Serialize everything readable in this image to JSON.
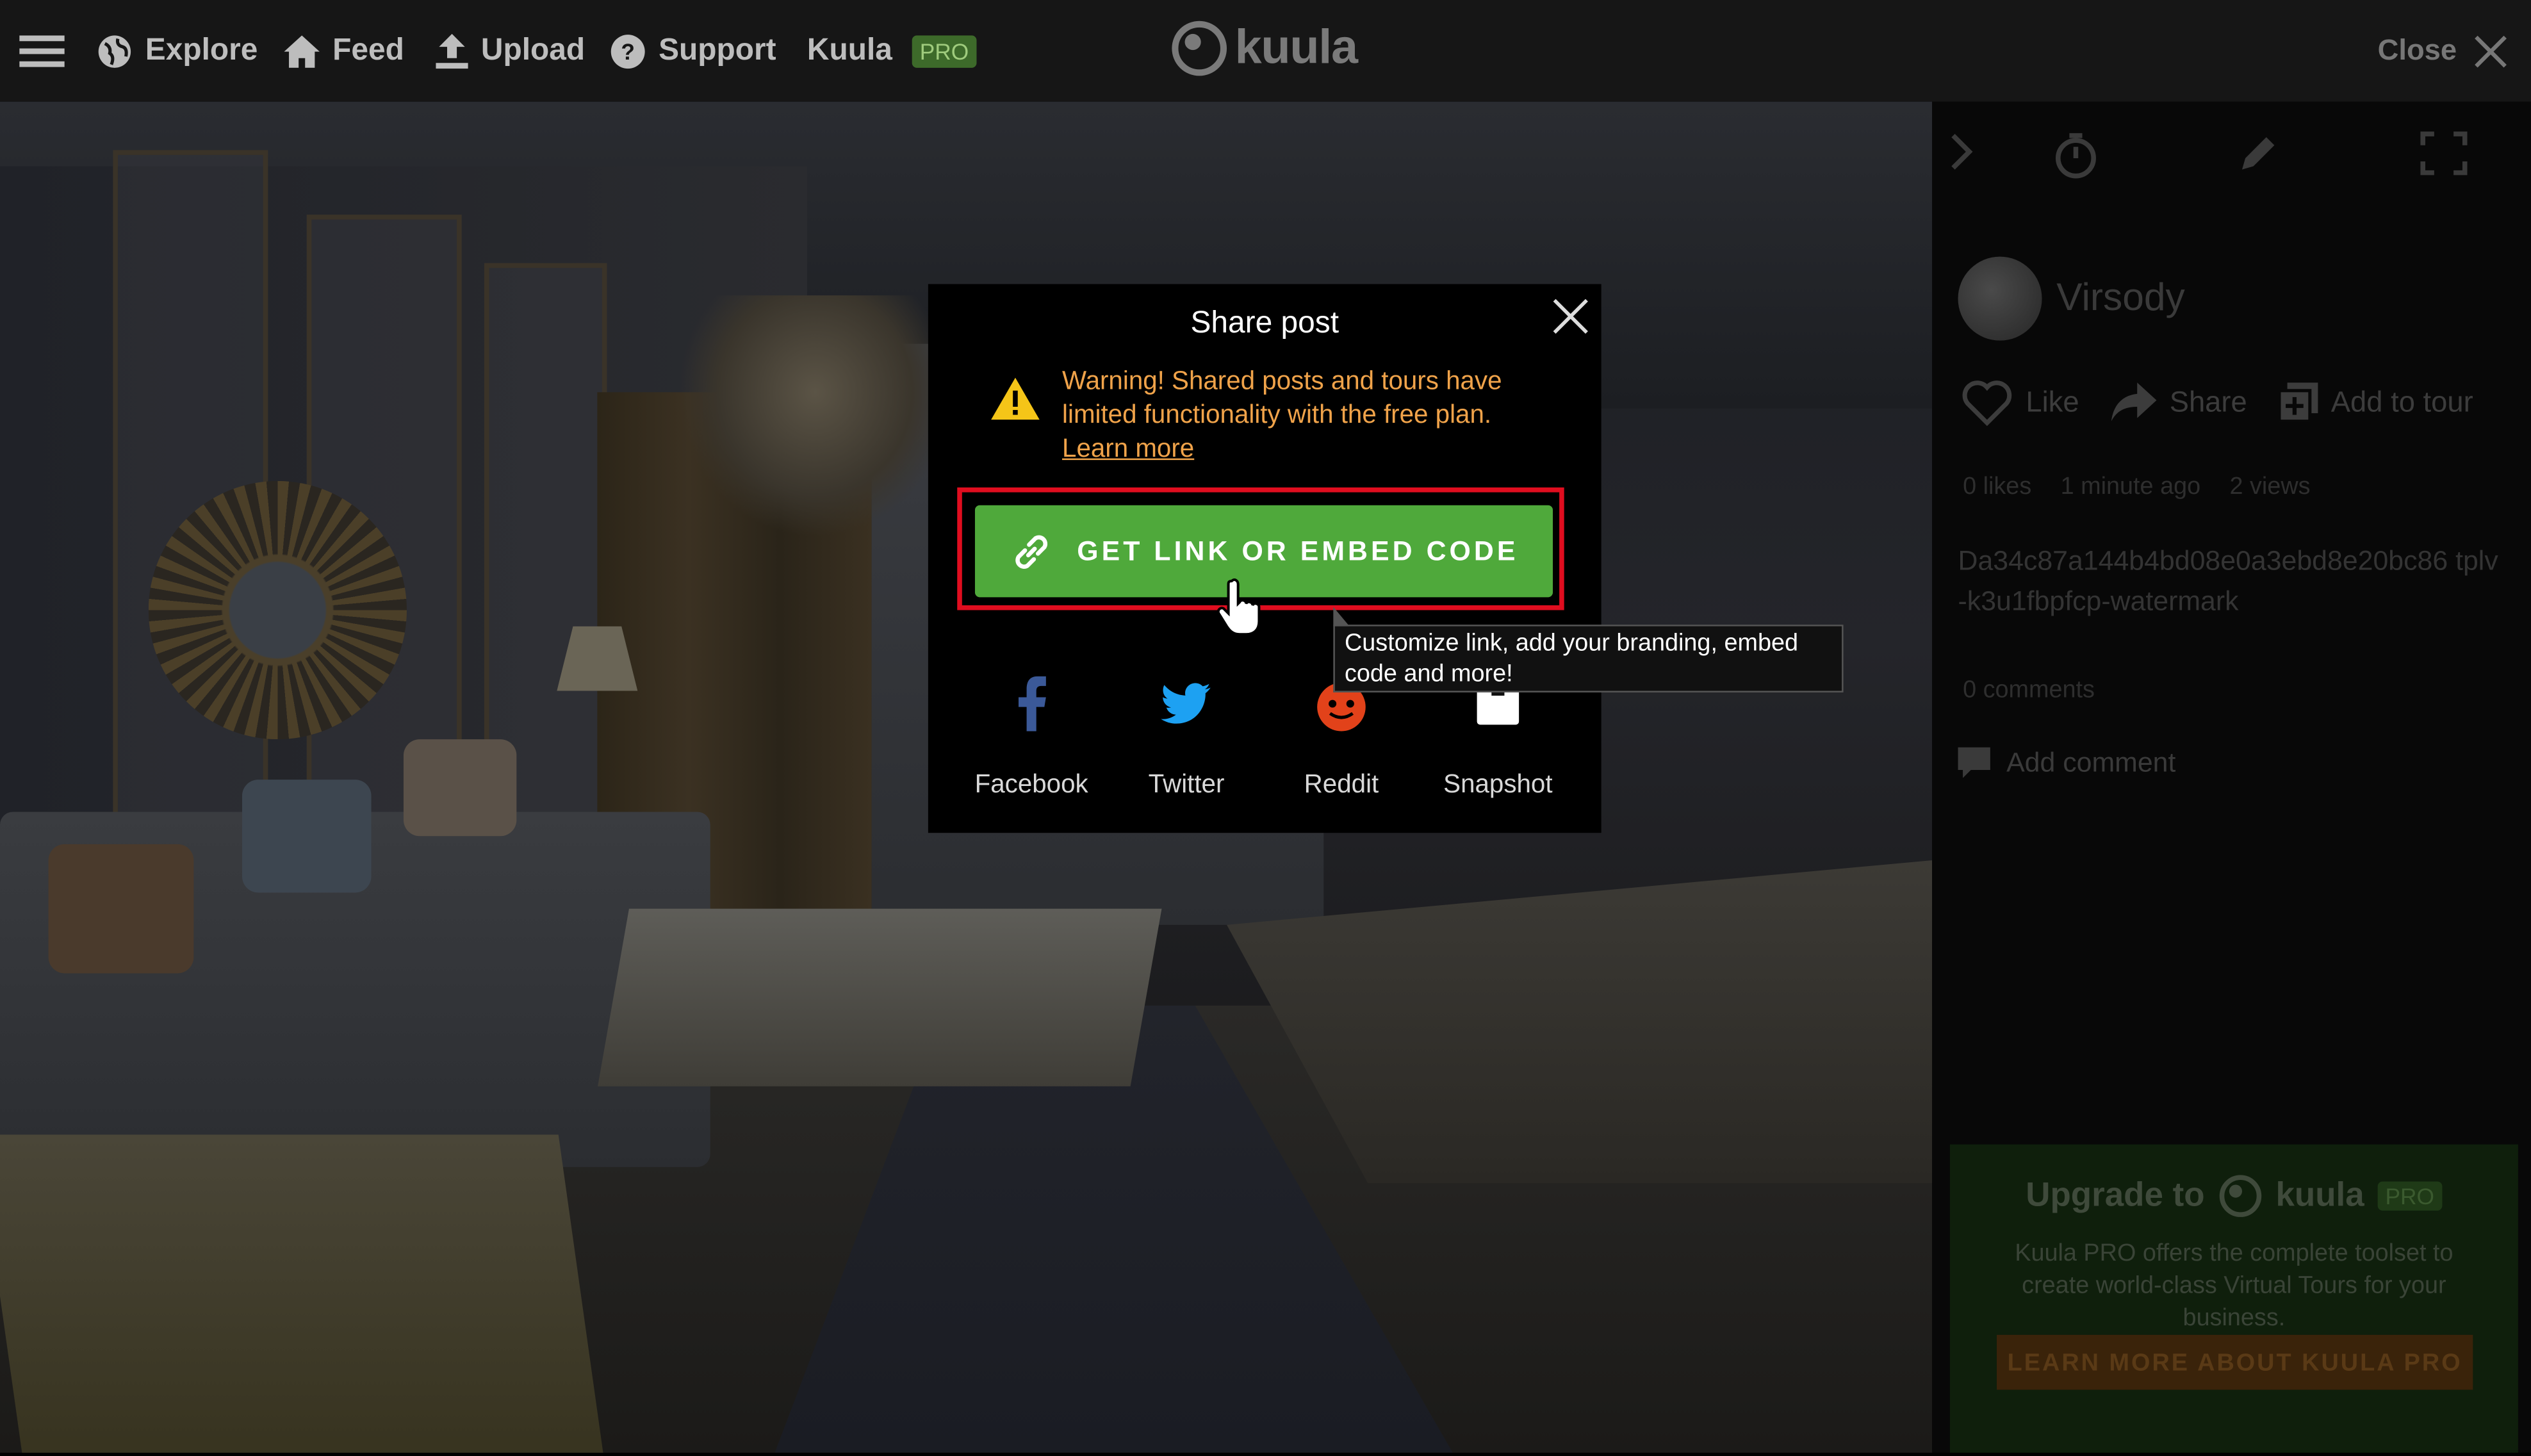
{
  "topbar": {
    "menu_icon": "hamburger-icon",
    "nav": [
      {
        "label": "Explore",
        "icon": "globe-icon"
      },
      {
        "label": "Feed",
        "icon": "home-icon"
      },
      {
        "label": "Upload",
        "icon": "upload-icon"
      },
      {
        "label": "Support",
        "icon": "help-icon"
      }
    ],
    "brand_label": "Kuula",
    "pro_badge": "PRO",
    "logo_text": "kuula",
    "close_label": "Close"
  },
  "modal": {
    "title": "Share post",
    "warning_text": "Warning! Shared posts and tours have limited functionality with the free plan.",
    "learn_more": "Learn more",
    "cta_label": "GET LINK OR EMBED CODE",
    "share_options": [
      {
        "label": "Facebook",
        "icon": "facebook-icon",
        "color": "#3b5998"
      },
      {
        "label": "Twitter",
        "icon": "twitter-icon",
        "color": "#1da1f2"
      },
      {
        "label": "Reddit",
        "icon": "reddit-icon",
        "color": "#ff4500"
      },
      {
        "label": "Snapshot",
        "icon": "snapshot-icon",
        "color": "#ffffff"
      }
    ],
    "tooltip": "Customize link, add your branding, embed code and more!"
  },
  "sidebar": {
    "user_name": "Virsody",
    "actions": [
      {
        "label": "Like",
        "icon": "heart-icon"
      },
      {
        "label": "Share",
        "icon": "share-icon"
      },
      {
        "label": "Add to tour",
        "icon": "add-to-tour-icon"
      }
    ],
    "stats": {
      "likes": "0 likes",
      "time": "1 minute ago",
      "views": "2 views"
    },
    "description": "Da34c87a144b4bd08e0a3ebd8e20bc86 tplv-k3u1fbpfcp-watermark",
    "comments": "0 comments",
    "add_comment": "Add comment",
    "upgrade": {
      "title_prefix": "Upgrade to",
      "logo_text": "kuula",
      "pro": "PRO",
      "description": "Kuula PRO offers the complete toolset to create world-class Virtual Tours for your business.",
      "button": "LEARN MORE ABOUT KUULA PRO"
    }
  },
  "colors": {
    "accent_green": "#4fa93b",
    "warning": "#f0a34a",
    "highlight_red": "#e00d1f"
  }
}
